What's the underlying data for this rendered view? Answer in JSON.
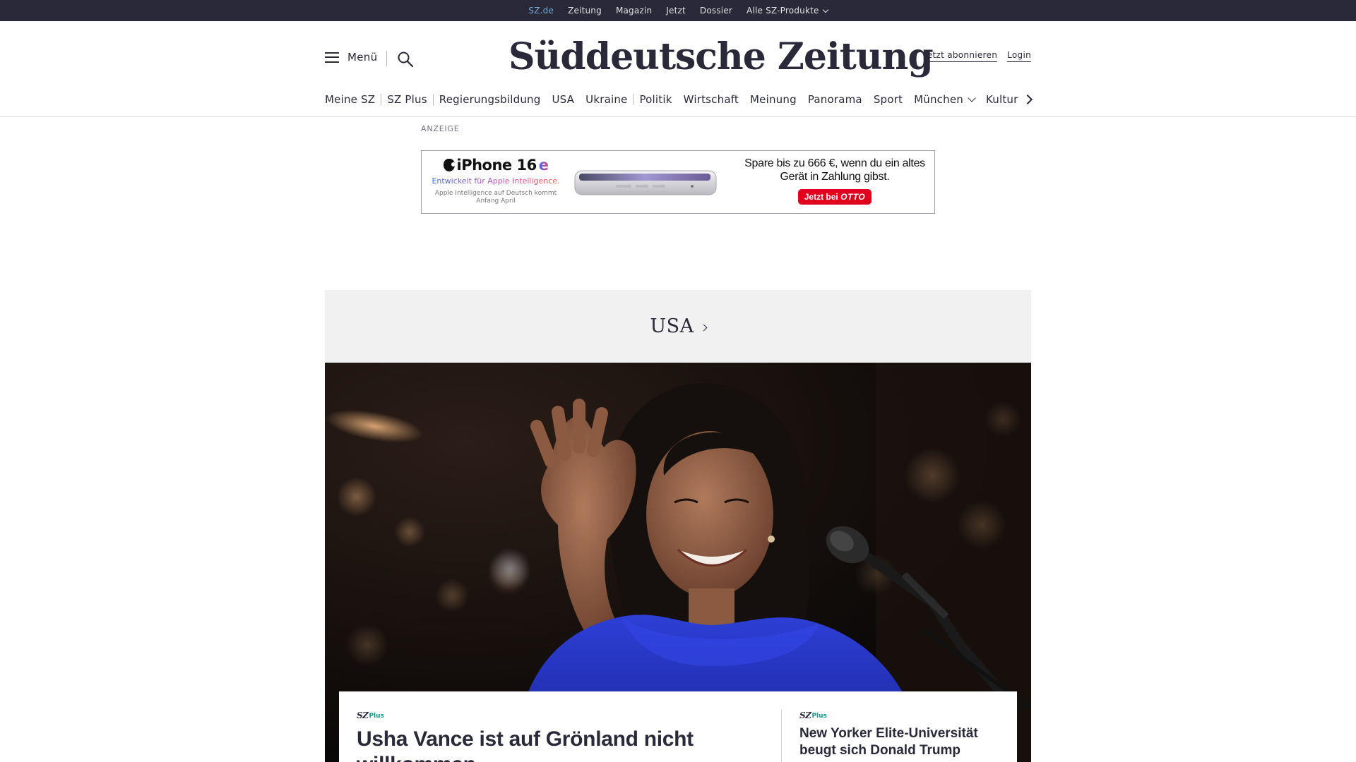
{
  "topbar": {
    "items": [
      {
        "label": "SZ.de"
      },
      {
        "label": "Zeitung"
      },
      {
        "label": "Magazin"
      },
      {
        "label": "Jetzt"
      },
      {
        "label": "Dossier"
      },
      {
        "label": "Alle SZ-Produkte"
      }
    ],
    "active_index": 0
  },
  "header": {
    "menu_label": "Menü",
    "logo_text": "Süddeutsche Zeitung",
    "subscribe_label": "Jetzt abonnieren",
    "login_label": "Login"
  },
  "nav": {
    "items": [
      {
        "label": "Meine SZ"
      },
      {
        "label": "SZ Plus"
      },
      {
        "label": "Regierungsbildung"
      },
      {
        "label": "USA"
      },
      {
        "label": "Ukraine"
      },
      {
        "label": "Politik"
      },
      {
        "label": "Wirtschaft"
      },
      {
        "label": "Meinung"
      },
      {
        "label": "Panorama"
      },
      {
        "label": "Sport"
      },
      {
        "label": "München"
      },
      {
        "label": "Kultur"
      }
    ]
  },
  "ad": {
    "label": "ANZEIGE",
    "brand": "iPhone 16",
    "brand_suffix": "e",
    "tagline": "Entwickelt für Apple Intelligence.",
    "note": "Apple Intelligence auf Deutsch kommt Anfang April",
    "offer": "Spare bis zu 666 €, wenn du ein altes Gerät in Zahlung gibst.",
    "cta": "Jetzt bei",
    "cta_brand": "OTTO"
  },
  "section": {
    "title": "USA"
  },
  "lead_article": {
    "badge_sz": "SZ",
    "badge_plus": "Plus",
    "title": "Usha Vance ist auf Grönland nicht willkommen"
  },
  "side_article": {
    "badge_sz": "SZ",
    "badge_plus": "Plus",
    "title": "New Yorker Elite-Universität beugt sich Donald Trump"
  },
  "colors": {
    "ink": "#29293a",
    "topbar_bg": "#29293a",
    "active_link": "#6fa9d4",
    "plus_green": "#0e9a8a",
    "section_bg": "#f1f1f1",
    "otto_red": "#e1001e"
  },
  "icons": [
    "hamburger-icon",
    "search-icon",
    "chevron-down-icon",
    "chevron-right-icon",
    "apple-logo-icon"
  ]
}
